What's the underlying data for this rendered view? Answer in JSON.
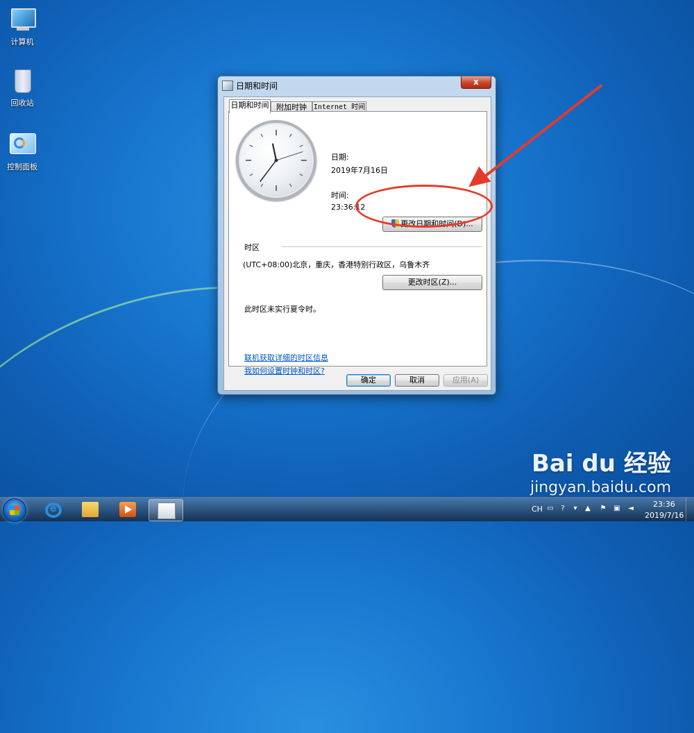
{
  "desktop": {
    "icons": [
      {
        "label": "计算机"
      },
      {
        "label": "回收站"
      },
      {
        "label": "控制面板"
      }
    ]
  },
  "dialog": {
    "title": "日期和时间",
    "close_label": "x",
    "tabs": [
      {
        "label": "日期和时间"
      },
      {
        "label": "附加时钟"
      },
      {
        "label": "Internet 时间"
      }
    ],
    "date_label": "日期:",
    "date_value": "2019年7月16日",
    "time_label": "时间:",
    "time_value": "23:36:12",
    "change_datetime_button": "更改日期和时间(D)...",
    "timezone_heading": "时区",
    "timezone_value": "(UTC+08:00)北京，重庆，香港特别行政区，乌鲁木齐",
    "change_timezone_button": "更改时区(Z)...",
    "dst_note": "此时区未实行夏令时。",
    "links": [
      "联机获取详细的时区信息",
      "我如何设置时钟和时区?"
    ],
    "ok_button": "确定",
    "cancel_button": "取消",
    "apply_button": "应用(A)"
  },
  "clock": {
    "hour": 23,
    "minute": 36,
    "second": 12
  },
  "taskbar": {
    "items": [
      "internet-explorer",
      "windows-explorer",
      "media-player",
      "date-time-control"
    ],
    "tray_lang": "CH",
    "tray_time": "23:36",
    "tray_date": "2019/7/16"
  },
  "watermark": {
    "brand": "Bai du 经验",
    "url": "jingyan.baidu.com"
  },
  "colors": {
    "annotation": "#e53a2a",
    "link": "#0055cc",
    "desktop": "#1877cf"
  }
}
